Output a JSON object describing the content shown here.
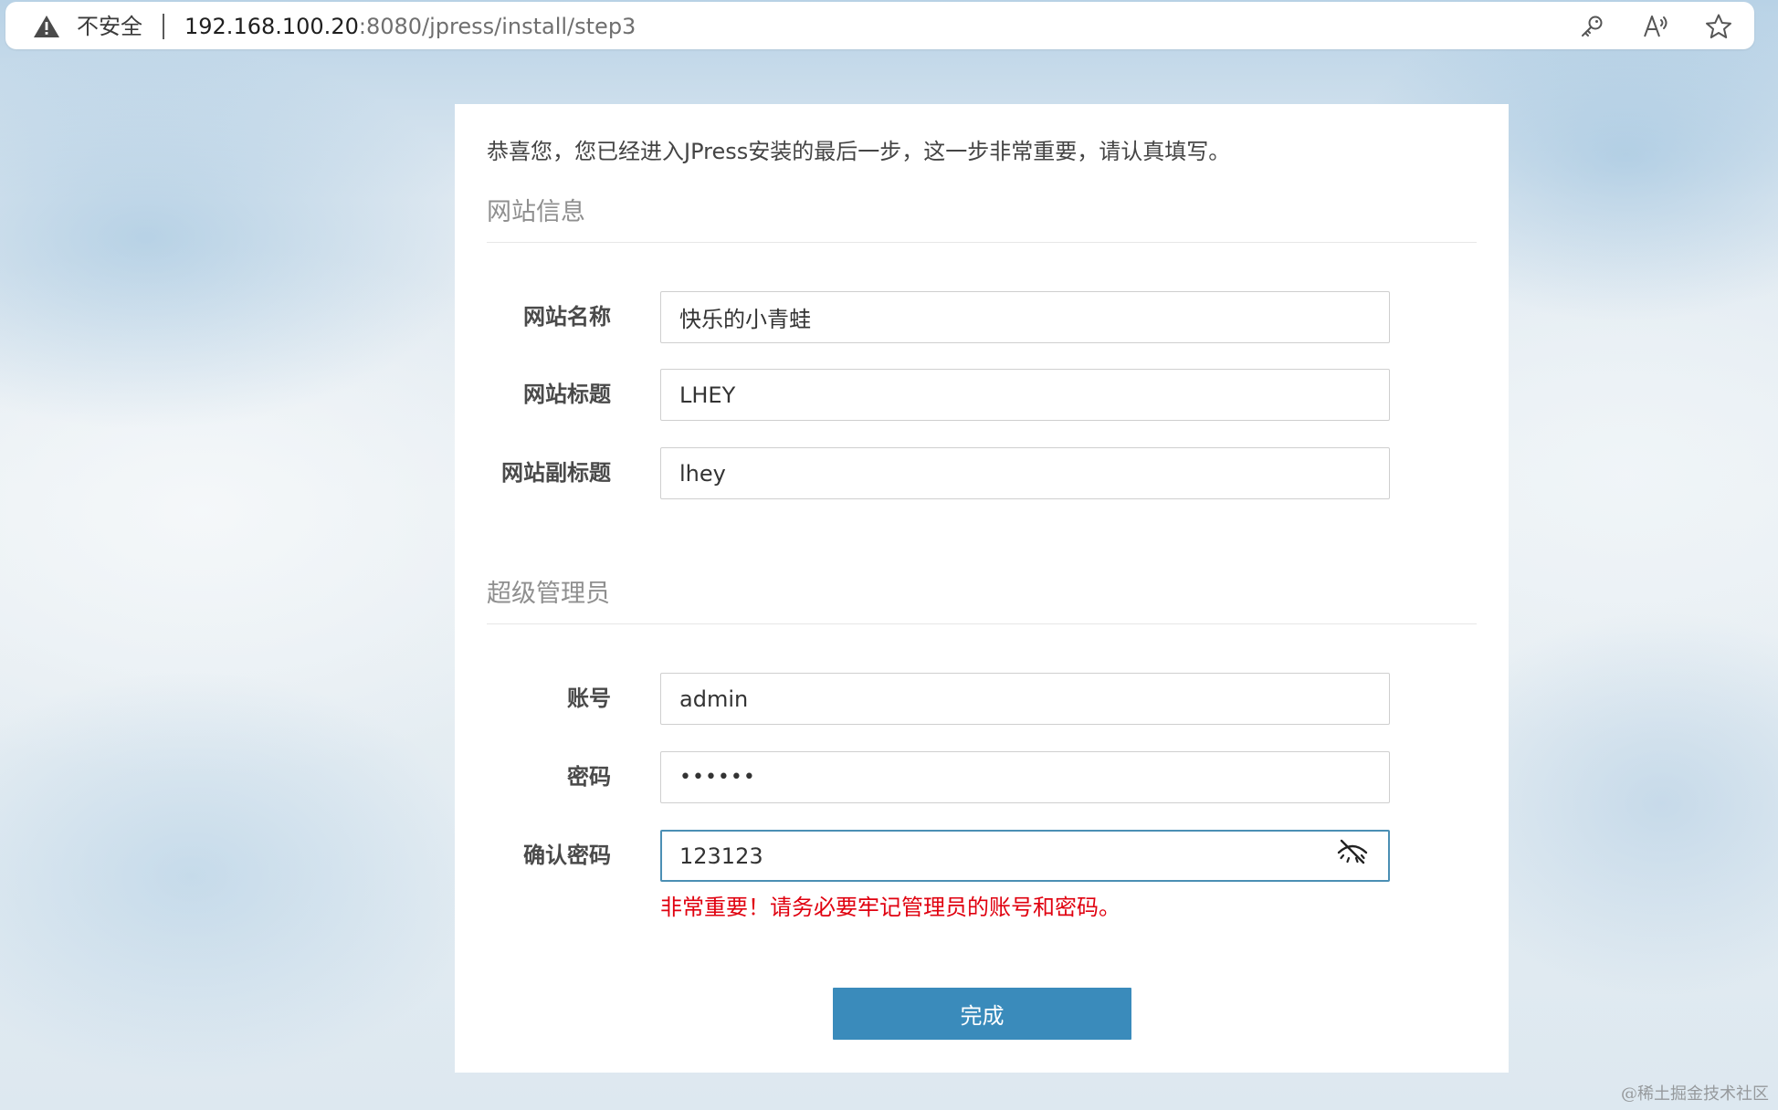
{
  "browser": {
    "security_label": "不安全",
    "url_host": "192.168.100.20",
    "url_rest": ":8080/jpress/install/step3",
    "icons": [
      "key-icon",
      "read-aloud-icon",
      "favorite-star-icon"
    ]
  },
  "install": {
    "intro": "恭喜您，您已经进入JPress安装的最后一步，这一步非常重要，请认真填写。",
    "site_section": {
      "title": "网站信息",
      "fields": [
        {
          "label": "网站名称",
          "value": "快乐的小青蛙"
        },
        {
          "label": "网站标题",
          "value": "LHEY"
        },
        {
          "label": "网站副标题",
          "value": "lhey"
        }
      ]
    },
    "admin_section": {
      "title": "超级管理员",
      "account": {
        "label": "账号",
        "value": "admin"
      },
      "password": {
        "label": "密码",
        "value": "••••••"
      },
      "confirm_password": {
        "label": "确认密码",
        "value": "123123"
      }
    },
    "warning": "非常重要！请务必要牢记管理员的账号和密码。",
    "finish_label": "完成"
  },
  "watermark": "@稀土掘金技术社区",
  "colors": {
    "button": "#3a8bbb",
    "warning": "#e0000f",
    "focus_border": "#4b8fb4"
  }
}
